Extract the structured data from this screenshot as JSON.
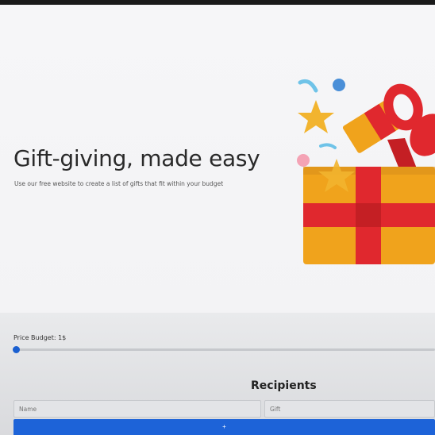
{
  "hero": {
    "title": "Gift-giving, made easy",
    "subtitle": "Use our free website to create a list of gifts that fit within your budget",
    "illustration": "gift-box-illustration"
  },
  "budget": {
    "label": "Price Budget: 1$",
    "slider_value_fraction": 0.0
  },
  "recipients": {
    "heading": "Recipients",
    "name_placeholder": "Name",
    "gift_placeholder": "Gift",
    "add_button_label": "+"
  },
  "colors": {
    "accent": "#1d63d8",
    "gift_box": "#f0a31c",
    "ribbon": "#e0282e",
    "star": "#f2b42f",
    "confetti_blue": "#4a8fd8",
    "confetti_pink": "#f4a3b5"
  }
}
